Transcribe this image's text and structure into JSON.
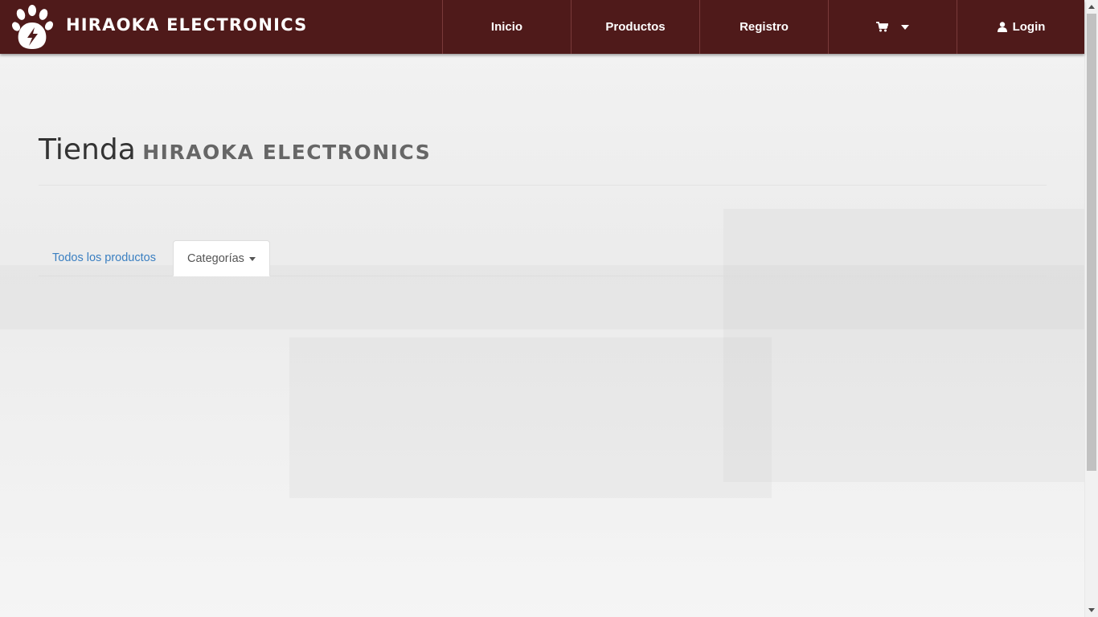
{
  "navbar": {
    "brand": "HIRAOKA ELECTRONICS",
    "logo_icon": "paw-lightning-icon",
    "items": [
      {
        "label": "Inicio"
      },
      {
        "label": "Productos"
      },
      {
        "label": "Registro"
      },
      {
        "label": "",
        "icon": "cart-icon",
        "dropdown": true
      },
      {
        "label": "Login",
        "icon": "user-icon"
      }
    ],
    "background_color": "#4f1a1a"
  },
  "page_header": {
    "title": "Tienda",
    "subtitle": "HIRAOKA ELECTRONICS"
  },
  "tabs": [
    {
      "label": "Todos los productos",
      "active": false
    },
    {
      "label": "Categorías",
      "active": true,
      "dropdown": true
    }
  ],
  "colors": {
    "link": "#3a7fc1",
    "text": "#333333"
  }
}
